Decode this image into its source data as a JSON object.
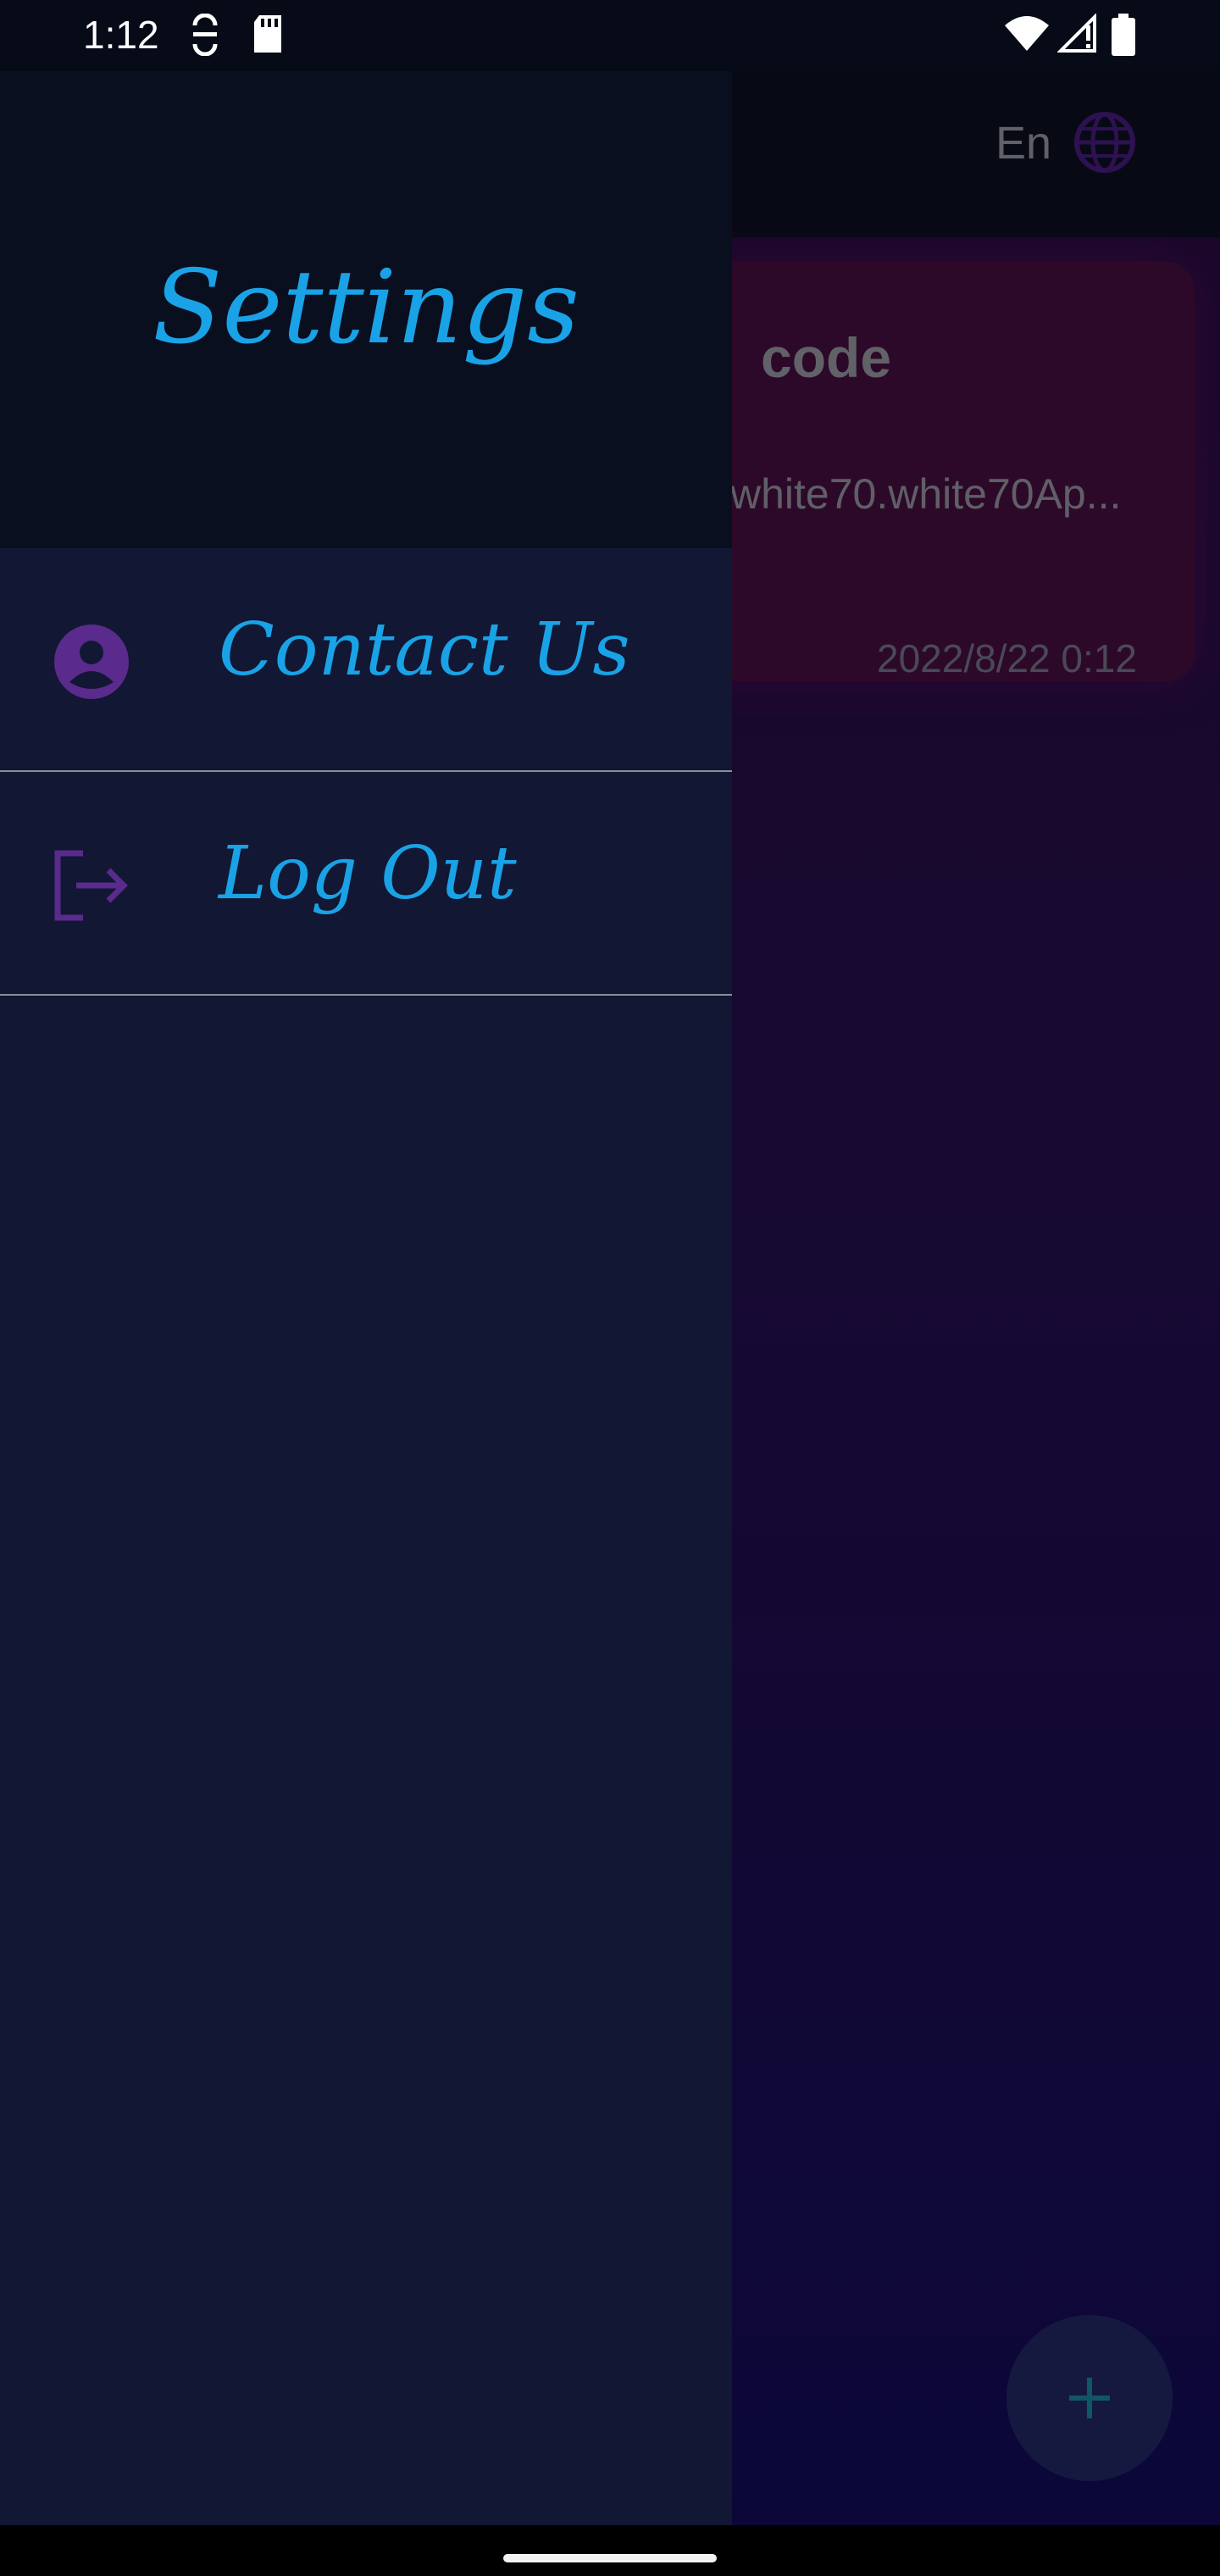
{
  "status_bar": {
    "time": "1:12",
    "icons": [
      "sync-icon",
      "sd-card-icon",
      "wifi-icon",
      "signal-icon",
      "battery-icon"
    ]
  },
  "app": {
    "language": "En",
    "card": {
      "title": "code",
      "subtitle": "white70.white70Ap...",
      "date": "2022/8/22 0:12"
    },
    "fab_icon": "plus-icon"
  },
  "drawer": {
    "title": "Settings",
    "items": [
      {
        "label": "Contact Us",
        "icon": "account-circle-icon"
      },
      {
        "label": "Log Out",
        "icon": "logout-icon"
      }
    ]
  },
  "colors": {
    "accent": "#1aa2e6",
    "icon_purple": "#5a2a8c",
    "drawer_bg": "#121733",
    "drawer_header_bg": "#0a0f20"
  }
}
